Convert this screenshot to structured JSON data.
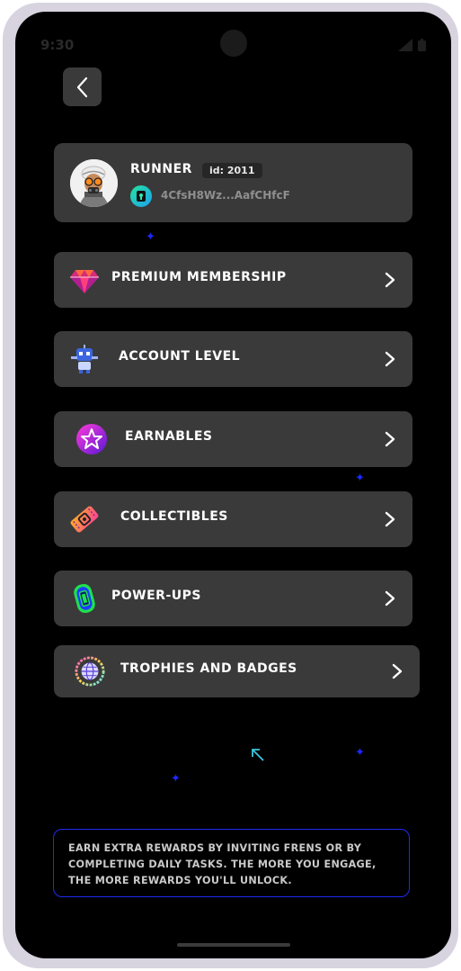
{
  "status_bar": {
    "time": "9:30"
  },
  "profile": {
    "name": "RUNNER",
    "id_label": "id: 2011",
    "wallet_address": "4CfsH8Wz...AafCHfcF"
  },
  "menu": [
    {
      "label": "PREMIUM MEMBERSHIP",
      "icon": "diamond-icon"
    },
    {
      "label": "ACCOUNT LEVEL",
      "icon": "robot-icon"
    },
    {
      "label": "EARNABLES",
      "icon": "star-badge-icon"
    },
    {
      "label": "COLLECTIBLES",
      "icon": "ticket-icon"
    },
    {
      "label": "POWER-UPS",
      "icon": "battery-icon"
    },
    {
      "label": "TROPHIES AND BADGES",
      "icon": "globe-badge-icon"
    }
  ],
  "info_text": "EARN EXTRA REWARDS BY INVITING FRENS OR BY COMPLETING DAILY TASKS. THE MORE YOU ENGAGE, THE MORE REWARDS YOU'LL UNLOCK.",
  "colors": {
    "background": "#000000",
    "card": "#3a3a3a",
    "accent_blue": "#1f2bf0",
    "text": "#ffffff",
    "muted_text": "#8f8f8f"
  }
}
